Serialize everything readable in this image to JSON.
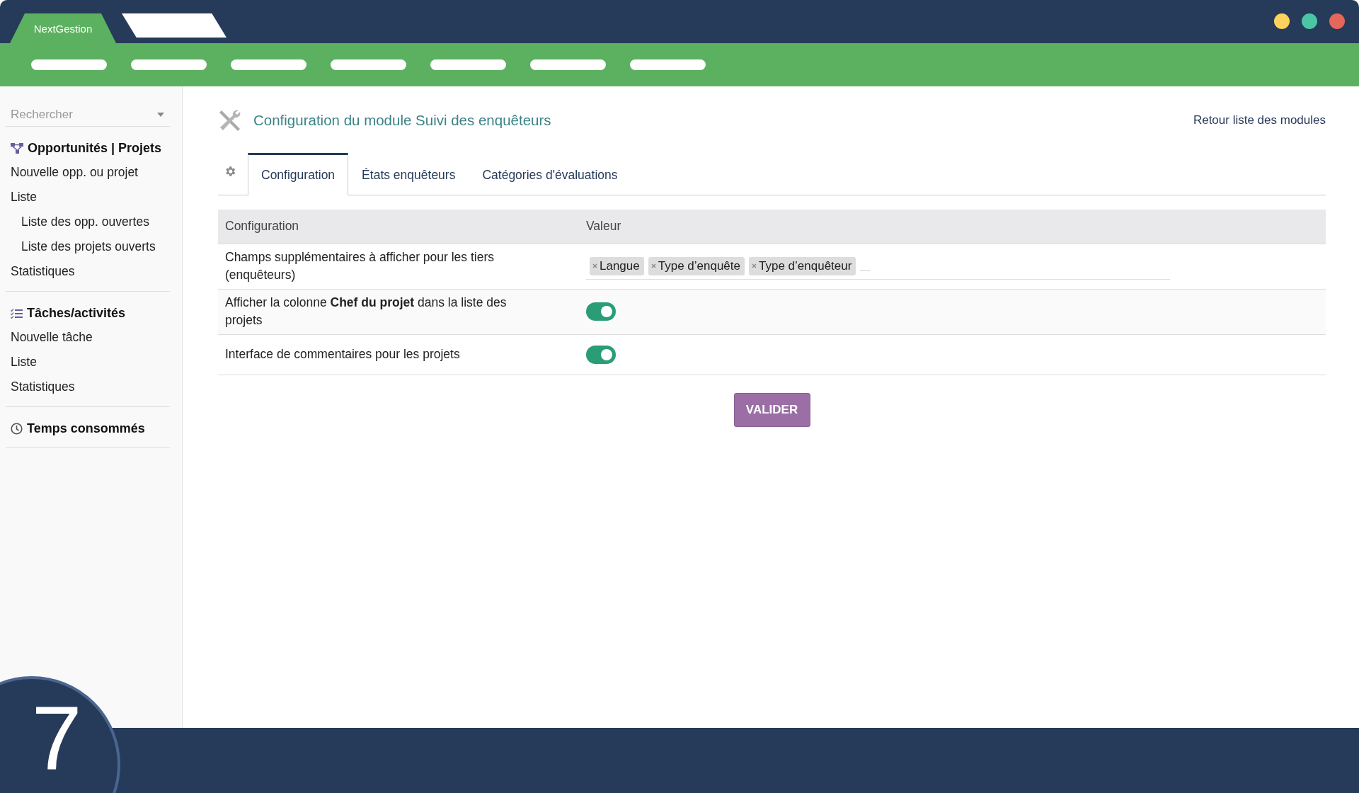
{
  "app_tabs": [
    {
      "label": "NextGestion",
      "selected": true
    },
    {
      "selected": false
    }
  ],
  "window_controls": [
    {
      "color": "#fdd25c"
    },
    {
      "color": "#4cc5a5"
    },
    {
      "color": "#e4675a"
    }
  ],
  "sidebar": {
    "search": {
      "placeholder": "Rechercher"
    },
    "sections": [
      {
        "title": "Opportunités | Projets",
        "items": [
          {
            "label": "Nouvelle opp. ou projet"
          },
          {
            "label": "Liste",
            "children": [
              {
                "label": "Liste des opp. ouvertes"
              },
              {
                "label": "Liste des projets ouverts"
              }
            ]
          },
          {
            "label": "Statistiques"
          }
        ]
      },
      {
        "title": "Tâches/activités",
        "items": [
          {
            "label": "Nouvelle tâche"
          },
          {
            "label": "Liste"
          },
          {
            "label": "Statistiques"
          }
        ]
      },
      {
        "title": "Temps consommés"
      }
    ]
  },
  "page": {
    "title": "Configuration du module Suivi des enquêteurs",
    "back_link": "Retour liste des modules"
  },
  "tabs": [
    {
      "label": "Configuration",
      "selected": true
    },
    {
      "label": "États enquêteurs",
      "selected": false
    },
    {
      "label": "Catégories d'évaluations",
      "selected": false
    }
  ],
  "table": {
    "columns": [
      "Configuration",
      "Valeur"
    ],
    "rows": [
      {
        "kind": "tags",
        "label": "Champs supplémentaires à afficher pour les tiers (enquêteurs)",
        "tags": [
          "Langue",
          "Type d’enquête",
          "Type d’enquêteur"
        ]
      },
      {
        "kind": "toggle",
        "label": "Afficher la colonne **Chef du projet** dans la liste des projets",
        "on": true
      },
      {
        "kind": "toggle",
        "label": "Interface de commentaires pour les projets",
        "on": true
      }
    ]
  },
  "submit_button": "VALIDER",
  "step_badge": "7"
}
